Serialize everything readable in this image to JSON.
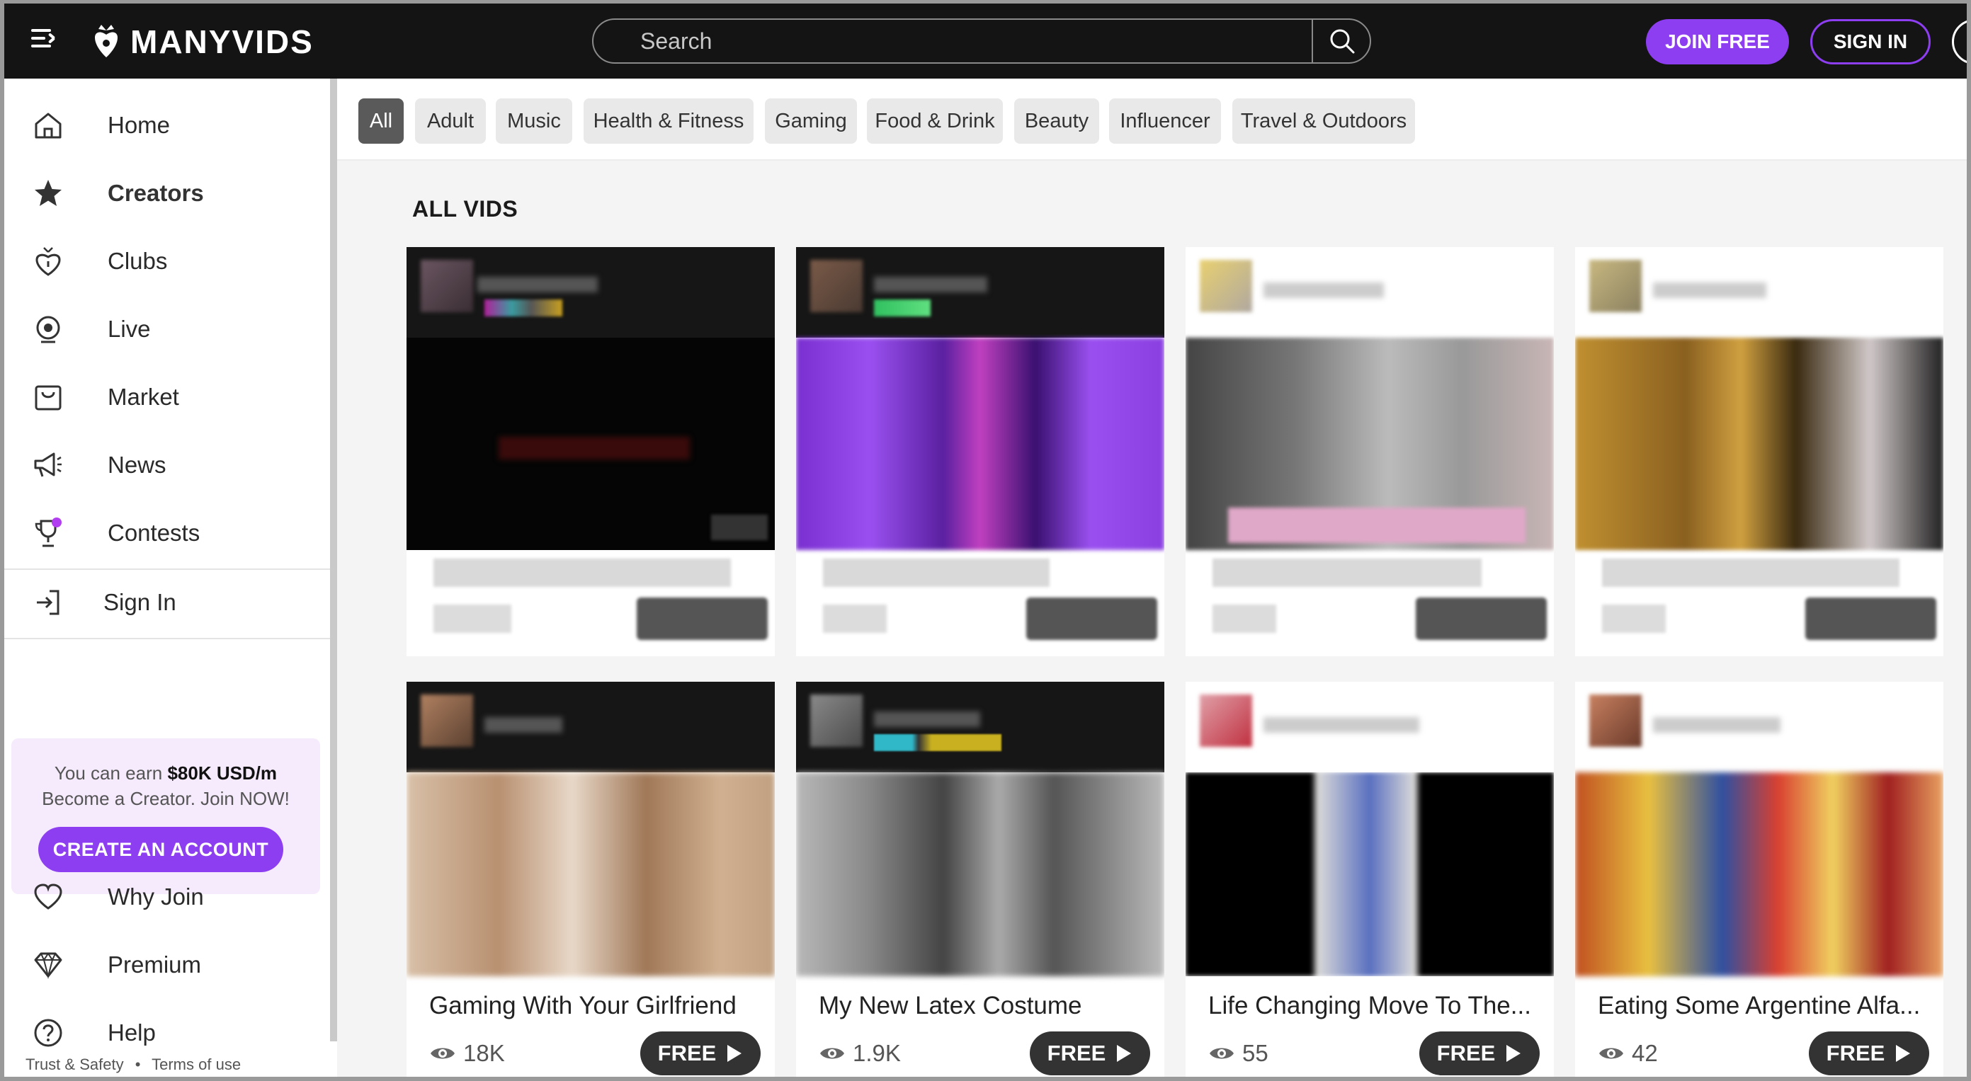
{
  "header": {
    "logo_text": "MANYVIDS",
    "search_placeholder": "Search",
    "join_label": "JOIN FREE",
    "signin_label": "SIGN IN"
  },
  "sidebar": {
    "items": [
      {
        "label": "Home",
        "icon": "home-icon"
      },
      {
        "label": "Creators",
        "icon": "star-icon"
      },
      {
        "label": "Clubs",
        "icon": "club-icon"
      },
      {
        "label": "Live",
        "icon": "live-icon"
      },
      {
        "label": "Market",
        "icon": "bag-icon"
      },
      {
        "label": "News",
        "icon": "megaphone-icon"
      },
      {
        "label": "Contests",
        "icon": "trophy-icon"
      }
    ],
    "signin_label": "Sign In",
    "promo": {
      "earn_prefix": "You can earn ",
      "earn_amount": "$80K USD/m",
      "line2": "Become a Creator. Join NOW!",
      "button": "CREATE AN ACCOUNT"
    },
    "more_items": [
      {
        "label": "Why Join",
        "icon": "heart-icon"
      },
      {
        "label": "Premium",
        "icon": "diamond-icon"
      },
      {
        "label": "Help",
        "icon": "help-icon"
      }
    ],
    "footer": {
      "trust": "Trust & Safety",
      "sep": "•",
      "terms": "Terms of use"
    }
  },
  "categories": [
    "All",
    "Adult",
    "Music",
    "Health & Fitness",
    "Gaming",
    "Food & Drink",
    "Beauty",
    "Influencer",
    "Travel & Outdoors"
  ],
  "active_category": "All",
  "section_title": "ALL VIDS",
  "videos": [
    {
      "title": "Gaming With Your Girlfriend",
      "views": "18K",
      "price": "FREE"
    },
    {
      "title": "My New Latex Costume",
      "views": "1.9K",
      "price": "FREE"
    },
    {
      "title": "Life Changing Move To The...",
      "views": "55",
      "price": "FREE"
    },
    {
      "title": "Eating Some Argentine Alfa...",
      "views": "42",
      "price": "FREE"
    }
  ],
  "colors": {
    "accent": "#8d3ef1",
    "header_bg": "#141414",
    "content_bg": "#f4f4f4"
  }
}
